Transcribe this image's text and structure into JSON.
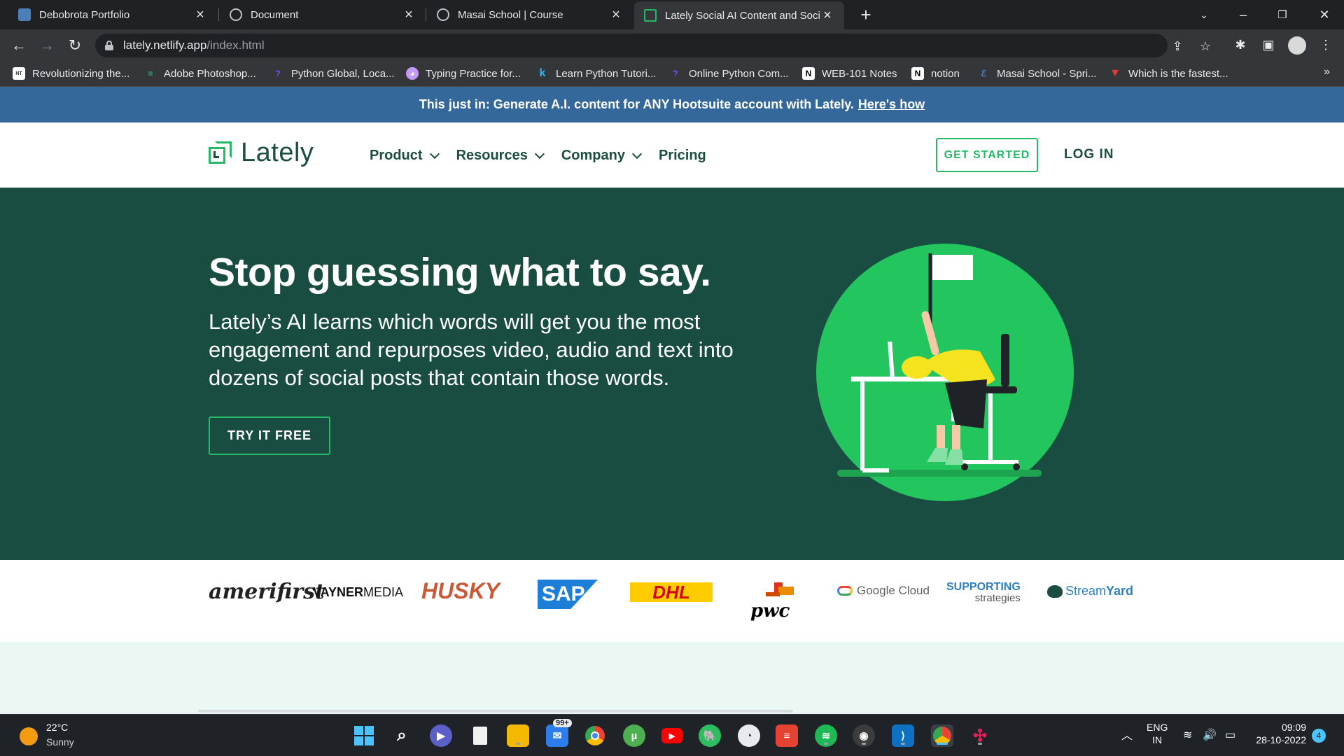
{
  "browser": {
    "tabs": [
      {
        "title": "Debobrota Portfolio",
        "active": false
      },
      {
        "title": "Document",
        "active": false
      },
      {
        "title": "Masai School | Course",
        "active": false
      },
      {
        "title": "Lately Social AI Content and Soci",
        "active": true
      }
    ],
    "url_host": "lately.netlify.app",
    "url_path": "/index.html",
    "bookmarks": [
      "Revolutionizing the...",
      "Adobe Photoshop...",
      "Python Global, Loca...",
      "Typing Practice for...",
      "Learn Python Tutori...",
      "Online Python Com...",
      "WEB-101 Notes",
      "notion",
      "Masai School - Spri...",
      "Which is the fastest..."
    ],
    "bookmarks_more": "»"
  },
  "banner": {
    "text": "This just in: Generate A.I. content for ANY Hootsuite account with Lately.",
    "link": "Here's how"
  },
  "nav": {
    "logo": "Lately",
    "menu": [
      {
        "label": "Product",
        "dropdown": true
      },
      {
        "label": "Resources",
        "dropdown": true
      },
      {
        "label": "Company",
        "dropdown": true
      },
      {
        "label": "Pricing",
        "dropdown": false
      }
    ],
    "cta": "GET STARTED",
    "login": "LOG IN"
  },
  "hero": {
    "title": "Stop guessing what to say.",
    "description": "Lately’s AI learns which words will get you the most engagement and repurposes video, audio and text into dozens of social posts that contain those words.",
    "button": "TRY IT FREE"
  },
  "brands": {
    "amerifirst": "amerifirst",
    "vayner_a": "VAYNER",
    "vayner_b": "MEDIA",
    "husky": "HUSKY",
    "sap": "SAP",
    "dhl": "DHL",
    "pwc": "pwc",
    "google": "Google Cloud",
    "supporting_a": "SUPPORTING",
    "supporting_b": "strategies",
    "stream_a": "Stream",
    "stream_b": "Yard"
  },
  "taskbar": {
    "temperature": "22°C",
    "weather": "Sunny",
    "badge_count": "99+",
    "lang_a": "ENG",
    "lang_b": "IN",
    "time": "09:09",
    "date": "28-10-2022",
    "notifications": "4"
  },
  "colors": {
    "brand_green": "#25b865",
    "hero_bg": "#1a4d42",
    "banner_bg": "#34689a"
  }
}
